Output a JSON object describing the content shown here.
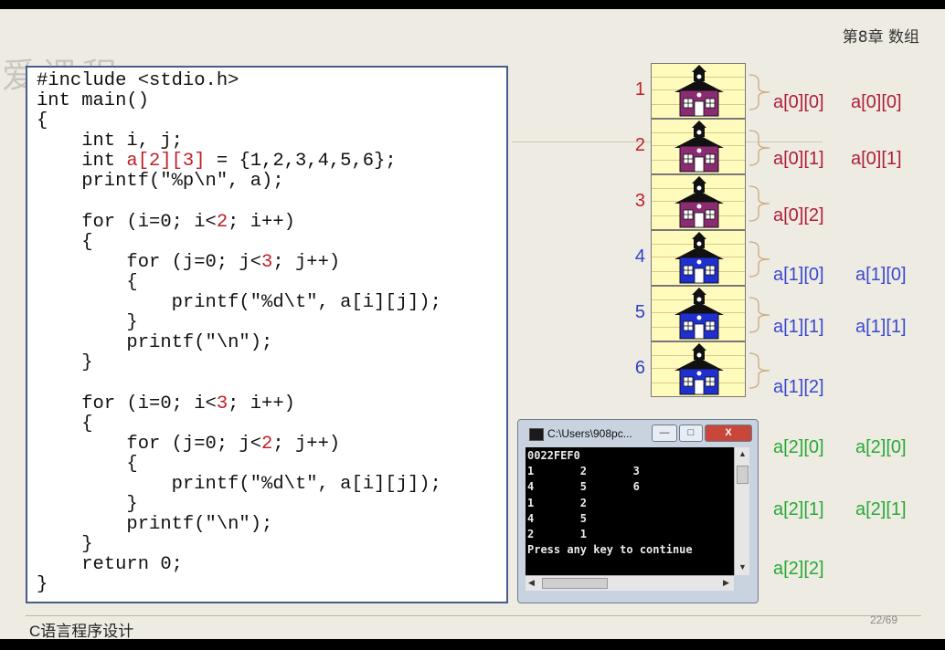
{
  "header": {
    "chapter": "第8章  数组"
  },
  "watermark": "爱课程",
  "code": {
    "lines": [
      [
        {
          "t": "#include <stdio.h>"
        }
      ],
      [
        {
          "t": "int main()"
        }
      ],
      [
        {
          "t": "{"
        }
      ],
      [
        {
          "t": "    int i, j;"
        }
      ],
      [
        {
          "t": "    int "
        },
        {
          "t": "a[2][3]",
          "red": true
        },
        {
          "t": " = {1,2,3,4,5,6};"
        }
      ],
      [
        {
          "t": "    printf(\"%p\\n\", a);"
        }
      ],
      [
        {
          "t": ""
        }
      ],
      [
        {
          "t": "    for (i=0; i<"
        },
        {
          "t": "2",
          "red": true
        },
        {
          "t": "; i++)"
        }
      ],
      [
        {
          "t": "    {"
        }
      ],
      [
        {
          "t": "        for (j=0; j<"
        },
        {
          "t": "3",
          "red": true
        },
        {
          "t": "; j++)"
        }
      ],
      [
        {
          "t": "        {"
        }
      ],
      [
        {
          "t": "            printf(\"%d\\t\", a[i][j]);"
        }
      ],
      [
        {
          "t": "        }"
        }
      ],
      [
        {
          "t": "        printf(\"\\n\");"
        }
      ],
      [
        {
          "t": "    }"
        }
      ],
      [
        {
          "t": ""
        }
      ],
      [
        {
          "t": "    for (i=0; i<"
        },
        {
          "t": "3",
          "red": true
        },
        {
          "t": "; i++)"
        }
      ],
      [
        {
          "t": "    {"
        }
      ],
      [
        {
          "t": "        for (j=0; j<"
        },
        {
          "t": "2",
          "red": true
        },
        {
          "t": "; j++)"
        }
      ],
      [
        {
          "t": "        {"
        }
      ],
      [
        {
          "t": "            printf(\"%d\\t\", a[i][j]);"
        }
      ],
      [
        {
          "t": "        }"
        }
      ],
      [
        {
          "t": "        printf(\"\\n\");"
        }
      ],
      [
        {
          "t": "    }"
        }
      ],
      [
        {
          "t": "    return 0;"
        }
      ],
      [
        {
          "t": "}"
        }
      ]
    ]
  },
  "memory": {
    "cells": [
      {
        "index": "1",
        "color": "#8b2c72"
      },
      {
        "index": "2",
        "color": "#8b2c72"
      },
      {
        "index": "3",
        "color": "#8b2c72"
      },
      {
        "index": "4",
        "color": "#1f2fd0"
      },
      {
        "index": "5",
        "color": "#1f2fd0"
      },
      {
        "index": "6",
        "color": "#1f2fd0"
      }
    ],
    "index_colors": [
      "#c0202a",
      "#c0202a",
      "#c0202a",
      "#3040c8",
      "#3040c8",
      "#3040c8"
    ],
    "labels_a": [
      {
        "text": "a[0][0]",
        "color": "#b01e3a"
      },
      {
        "text": "a[0][1]",
        "color": "#b01e3a"
      },
      {
        "text": "a[0][2]",
        "color": "#b01e3a"
      },
      {
        "text": "a[1][0]",
        "color": "#3a48d0"
      },
      {
        "text": "a[1][1]",
        "color": "#3a48d0"
      },
      {
        "text": "a[1][2]",
        "color": "#3a48d0"
      },
      {
        "text": "a[2][0]",
        "color": "#28a838"
      },
      {
        "text": "a[2][1]",
        "color": "#28a838"
      },
      {
        "text": "a[2][2]",
        "color": "#28a838"
      }
    ],
    "labels_b": [
      {
        "text": "a[0][0]",
        "color": "#b01e3a"
      },
      {
        "text": "a[0][1]",
        "color": "#b01e3a"
      },
      {
        "text": "a[1][0]",
        "color": "#3a48d0"
      },
      {
        "text": "a[1][1]",
        "color": "#3a48d0"
      },
      {
        "text": "a[2][0]",
        "color": "#28a838"
      },
      {
        "text": "a[2][1]",
        "color": "#28a838"
      }
    ]
  },
  "console": {
    "title": "C:\\Users\\908pc...",
    "minimize": "—",
    "maximize": "□",
    "close": "X",
    "output": [
      "0022FEF0",
      "1       2       3",
      "4       5       6",
      "1       2",
      "4       5",
      "2       1",
      "Press any key to continue"
    ]
  },
  "footer": {
    "title": "C语言程序设计",
    "page": "22/69"
  }
}
